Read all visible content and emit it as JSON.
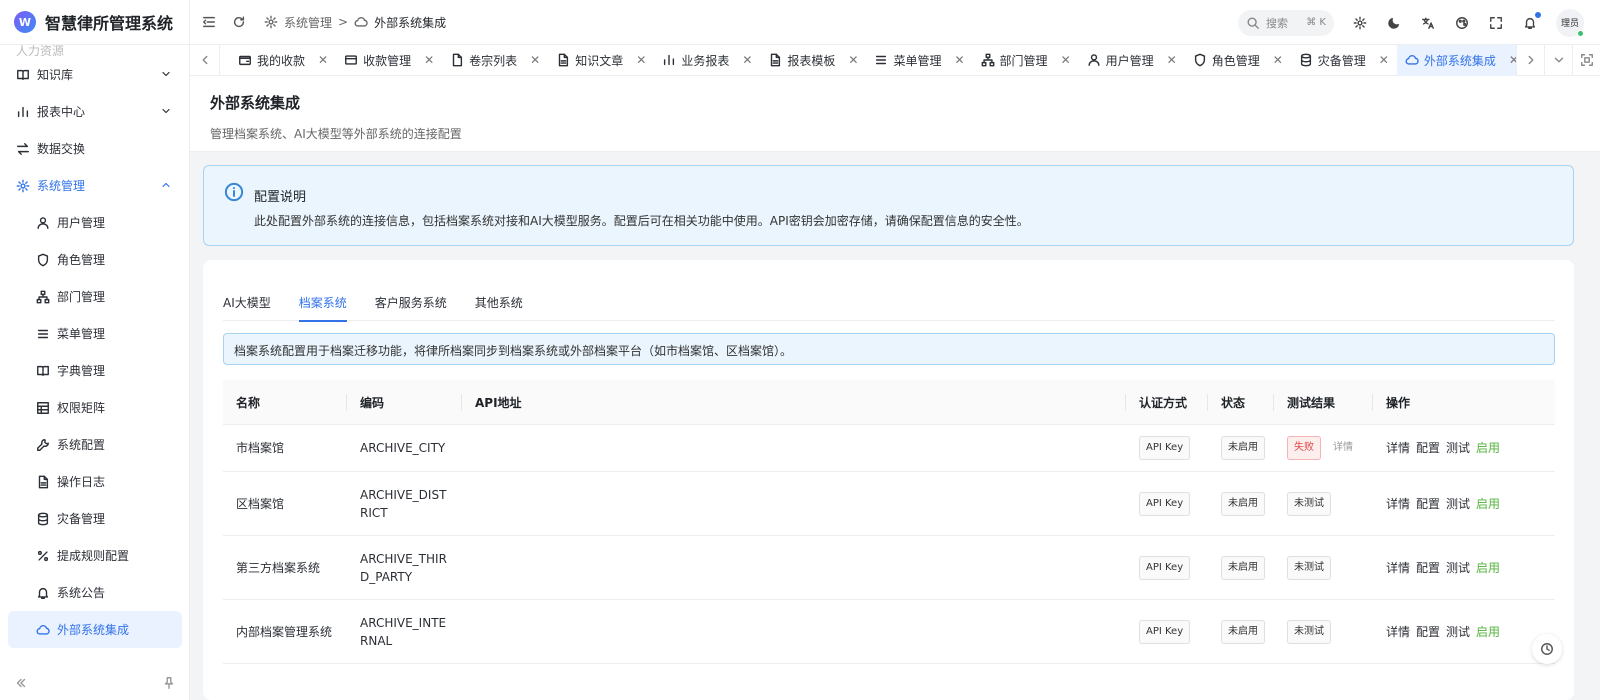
{
  "app": {
    "title": "智慧律所管理系统",
    "logo_letter": "W"
  },
  "sidebar": {
    "partial_item": "人力资源",
    "groups": [
      {
        "label": "知识库",
        "icon": "book-icon"
      },
      {
        "label": "报表中心",
        "icon": "bar-chart-icon"
      },
      {
        "label": "数据交换",
        "icon": "swap-icon"
      },
      {
        "label": "系统管理",
        "icon": "gear-icon"
      }
    ],
    "items": [
      {
        "label": "用户管理",
        "icon": "user-icon"
      },
      {
        "label": "角色管理",
        "icon": "shield-icon"
      },
      {
        "label": "部门管理",
        "icon": "org-icon"
      },
      {
        "label": "菜单管理",
        "icon": "menu-icon"
      },
      {
        "label": "字典管理",
        "icon": "book-icon"
      },
      {
        "label": "权限矩阵",
        "icon": "grid-icon"
      },
      {
        "label": "系统配置",
        "icon": "wrench-icon"
      },
      {
        "label": "操作日志",
        "icon": "file-icon"
      },
      {
        "label": "灾备管理",
        "icon": "database-icon"
      },
      {
        "label": "提成规则配置",
        "icon": "percent-icon"
      },
      {
        "label": "系统公告",
        "icon": "bell-icon"
      },
      {
        "label": "外部系统集成",
        "icon": "cloud-icon"
      }
    ]
  },
  "header": {
    "breadcrumb": [
      "系统管理",
      "外部系统集成"
    ],
    "search_placeholder": "搜索",
    "search_shortcut": "⌘ K",
    "user": "理员"
  },
  "tabs": [
    {
      "label": "我的收款",
      "icon": "wallet-icon"
    },
    {
      "label": "收款管理",
      "icon": "card-icon"
    },
    {
      "label": "卷宗列表",
      "icon": "file-icon"
    },
    {
      "label": "知识文章",
      "icon": "file-icon"
    },
    {
      "label": "业务报表",
      "icon": "bar-chart-icon"
    },
    {
      "label": "报表模板",
      "icon": "file-icon"
    },
    {
      "label": "菜单管理",
      "icon": "menu-icon"
    },
    {
      "label": "部门管理",
      "icon": "org-icon"
    },
    {
      "label": "用户管理",
      "icon": "user-icon"
    },
    {
      "label": "角色管理",
      "icon": "shield-icon"
    },
    {
      "label": "灾备管理",
      "icon": "database-icon"
    },
    {
      "label": "外部系统集成",
      "icon": "cloud-icon"
    }
  ],
  "page": {
    "title": "外部系统集成",
    "subtitle": "管理档案系统、AI大模型等外部系统的连接配置"
  },
  "info": {
    "title": "配置说明",
    "text": "此处配置外部系统的连接信息，包括档案系统对接和AI大模型服务。配置后可在相关功能中使用。API密钥会加密存储，请确保配置信息的安全性。"
  },
  "sub_tabs": [
    "AI大模型",
    "档案系统",
    "客户服务系统",
    "其他系统"
  ],
  "alert": "档案系统配置用于档案迁移功能，将律所档案同步到档案系统或外部档案平台（如市档案馆、区档案馆）。",
  "table": {
    "headers": [
      "名称",
      "编码",
      "API地址",
      "认证方式",
      "状态",
      "测试结果",
      "操作"
    ],
    "rows": [
      {
        "name": "市档案馆",
        "code": "ARCHIVE_CITY",
        "api": "",
        "auth": "API Key",
        "status": "未启用",
        "test": "失败",
        "test_detail": "详情"
      },
      {
        "name": "区档案馆",
        "code": "ARCHIVE_DISTRICT",
        "api": "",
        "auth": "API Key",
        "status": "未启用",
        "test": "未测试",
        "test_detail": ""
      },
      {
        "name": "第三方档案系统",
        "code": "ARCHIVE_THIRD_PARTY",
        "api": "",
        "auth": "API Key",
        "status": "未启用",
        "test": "未测试",
        "test_detail": ""
      },
      {
        "name": "内部档案管理系统",
        "code": "ARCHIVE_INTERNAL",
        "api": "",
        "auth": "API Key",
        "status": "未启用",
        "test": "未测试",
        "test_detail": ""
      }
    ],
    "actions": [
      "详情",
      "配置",
      "测试",
      "启用"
    ]
  },
  "colors": {
    "accent": "#3273e8",
    "success": "#52b53b",
    "danger": "#e04848"
  }
}
